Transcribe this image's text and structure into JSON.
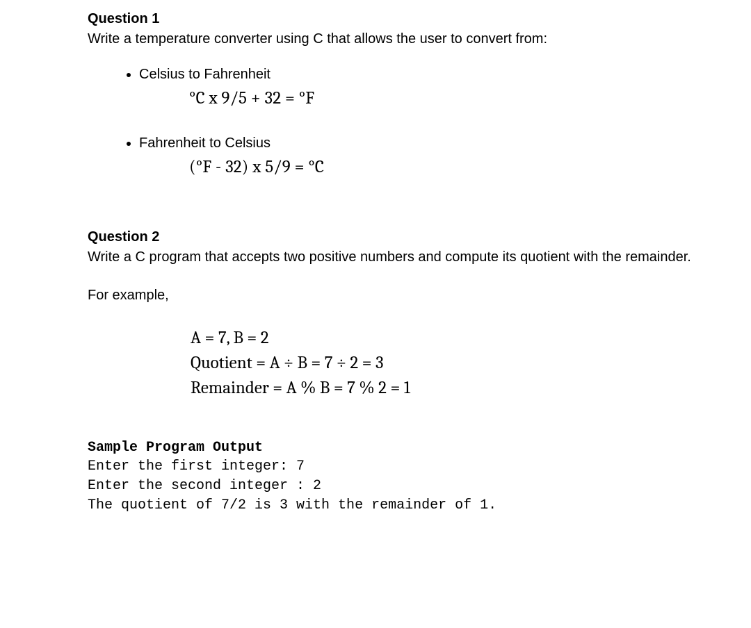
{
  "q1": {
    "heading": "Question 1",
    "intro": "Write a temperature converter using C that allows the user to convert from:",
    "bullets": [
      {
        "label": "Celsius to Fahrenheit",
        "formula": "°C  x  9/5 + 32 = °F"
      },
      {
        "label": "Fahrenheit to Celsius",
        "formula": "(°F  -  32)  x  5/9 = °C"
      }
    ]
  },
  "q2": {
    "heading": "Question 2",
    "intro": "Write a C program that accepts two positive numbers and compute its quotient with the remainder.",
    "for_example": "For example,",
    "math": {
      "line1": "A = 7, B = 2",
      "line2": "Quotient = A ÷ B = 7 ÷ 2 = 3",
      "line3": "Remainder = A % B = 7 % 2 = 1"
    },
    "sample_heading": "Sample Program Output",
    "sample_output": "Enter the first integer: 7\nEnter the second integer : 2\nThe quotient of 7/2 is 3 with the remainder of 1."
  }
}
